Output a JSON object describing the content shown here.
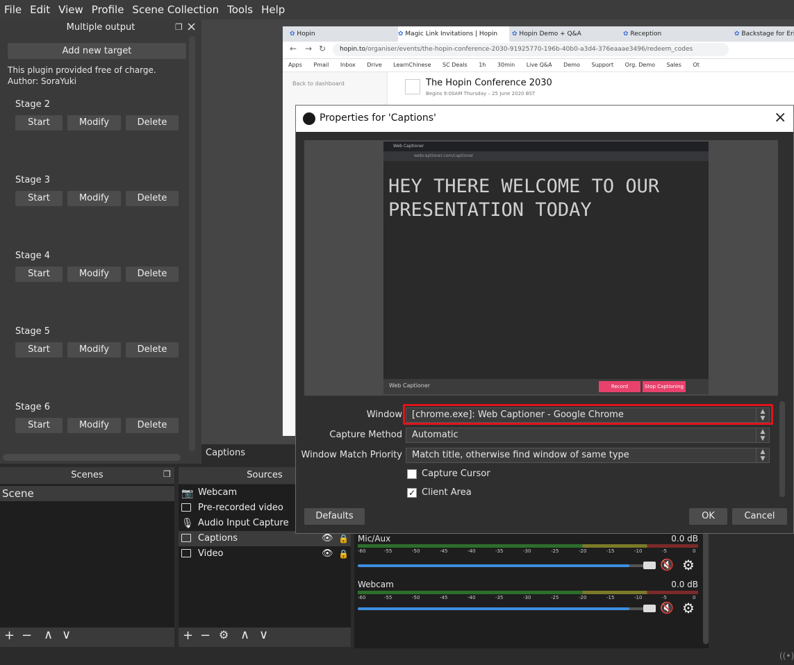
{
  "menu": [
    "File",
    "Edit",
    "View",
    "Profile",
    "Scene Collection",
    "Tools",
    "Help"
  ],
  "multiple_output": {
    "title": "Multiple output",
    "add_target": "Add new target",
    "note_line1": "This plugin provided free of charge.",
    "note_line2": "Author: SoraYuki",
    "stages": [
      {
        "name": "Stage 2",
        "start": "Start",
        "modify": "Modify",
        "delete": "Delete"
      },
      {
        "name": "Stage 3",
        "start": "Start",
        "modify": "Modify",
        "delete": "Delete"
      },
      {
        "name": "Stage 4",
        "start": "Start",
        "modify": "Modify",
        "delete": "Delete"
      },
      {
        "name": "Stage 5",
        "start": "Start",
        "modify": "Modify",
        "delete": "Delete"
      },
      {
        "name": "Stage 6",
        "start": "Start",
        "modify": "Modify",
        "delete": "Delete"
      }
    ]
  },
  "browser": {
    "tabs": [
      "Hopin",
      "Magic Link Invitations | Hopin",
      "Hopin Demo + Q&A",
      "Reception",
      "Backstage for Erin"
    ],
    "url_host": "hopin.to",
    "url_path": "/organiser/events/the-hopin-conference-2030-91925770-196b-40b0-a3d4-376eaaae3496/redeem_codes",
    "bookmarks": [
      "Apps",
      "Pmail",
      "Inbox",
      "Drive",
      "LearnChinese",
      "SC Deals",
      "1h",
      "30min",
      "Live Q&A",
      "Demo",
      "Support",
      "Org. Demo",
      "Sales",
      "Ot"
    ],
    "back_link": "Back to dashboard",
    "event_title": "The Hopin Conference 2030",
    "event_sub": "Begins 9:00AM Thursday – 25 June 2020 BST"
  },
  "dialog": {
    "title": "Properties for 'Captions'",
    "preview": {
      "caption_line1": "HEY THERE WELCOME TO OUR",
      "caption_line2": "PRESENTATION TODAY",
      "inner_tab": "Web Captioner",
      "inner_url": "webcaptioner.com/captioner",
      "footer_brand": "Web Captioner",
      "footer_btn1": "Record",
      "footer_btn2": "Stop Captioning"
    },
    "window_label": "Window",
    "window_value": "[chrome.exe]: Web Captioner - Google Chrome",
    "capture_method_label": "Capture Method",
    "capture_method_value": "Automatic",
    "priority_label": "Window Match Priority",
    "priority_value": "Match title, otherwise find window of same type",
    "capture_cursor": "Capture Cursor",
    "capture_cursor_checked": false,
    "client_area": "Client Area",
    "client_area_checked": true,
    "defaults": "Defaults",
    "ok": "OK",
    "cancel": "Cancel"
  },
  "current_source": "Captions",
  "scenes": {
    "title": "Scenes",
    "items": [
      "Scene"
    ]
  },
  "sources": {
    "title": "Sources",
    "items": [
      {
        "name": "Webcam",
        "icon": "camera-icon"
      },
      {
        "name": "Pre-recorded video",
        "icon": "window-icon"
      },
      {
        "name": "Audio Input Capture",
        "icon": "microphone-icon"
      },
      {
        "name": "Captions",
        "icon": "window-icon"
      },
      {
        "name": "Video",
        "icon": "window-icon"
      }
    ]
  },
  "mixer": {
    "channels": [
      {
        "name": "Mic/Aux",
        "db": "0.0 dB",
        "level": 0.93
      },
      {
        "name": "Webcam",
        "db": "0.0 dB",
        "level": 0.93
      }
    ],
    "scale": [
      "-60",
      "-55",
      "-50",
      "-45",
      "-40",
      "-35",
      "-30",
      "-25",
      "-20",
      "-15",
      "-10",
      "-5",
      "0"
    ]
  },
  "colors": {
    "highlight_red": "#e0141a",
    "slider_blue": "#3d8ee0",
    "caption_green": "#2a9d3a",
    "stop_pink": "#e8416c"
  }
}
